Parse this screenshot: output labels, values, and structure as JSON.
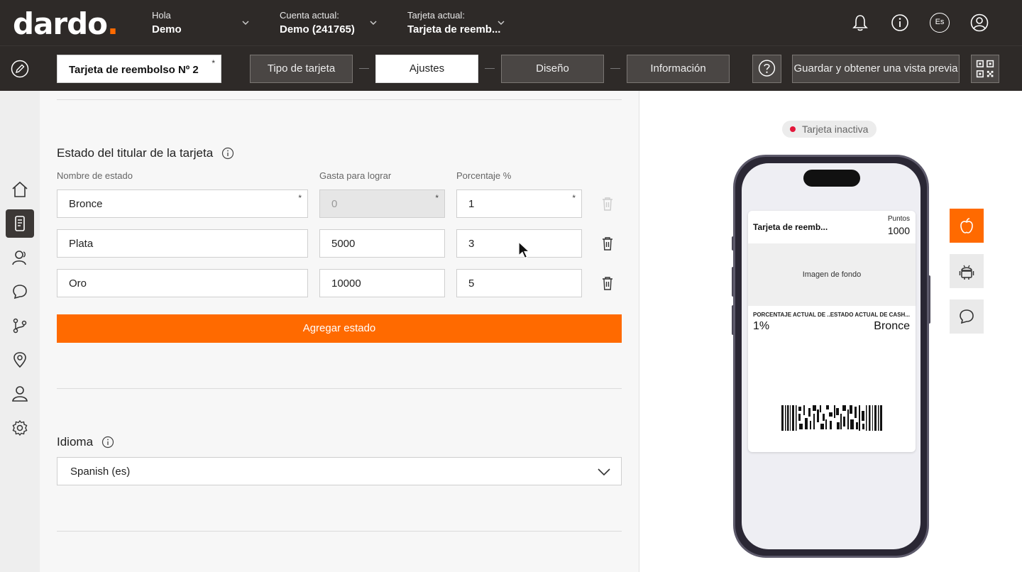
{
  "header": {
    "logo_text": "dardo",
    "logo_dot": ".",
    "greeting_label": "Hola",
    "greeting_name": "Demo",
    "account_label": "Cuenta actual:",
    "account_value": "Demo (241765)",
    "card_label": "Tarjeta actual:",
    "card_value": "Tarjeta de reemb...",
    "language_badge": "Es"
  },
  "toolbar": {
    "card_name": "Tarjeta de reembolso Nº 2",
    "required_mark": "*",
    "steps": [
      {
        "label": "Tipo de tarjeta",
        "active": false
      },
      {
        "label": "Ajustes",
        "active": true
      },
      {
        "label": "Diseño",
        "active": false
      },
      {
        "label": "Información",
        "active": false
      }
    ],
    "save_label": "Guardar y obtener una vista previa"
  },
  "holder_status": {
    "title": "Estado del titular de la tarjeta",
    "col_name": "Nombre de estado",
    "col_spend": "Gasta para lograr",
    "col_percent": "Porcentaje %",
    "rows": [
      {
        "name": "Bronce",
        "spend": "0",
        "percent": "1"
      },
      {
        "name": "Plata",
        "spend": "5000",
        "percent": "3"
      },
      {
        "name": "Oro",
        "spend": "10000",
        "percent": "5"
      }
    ],
    "add_label": "Agregar estado"
  },
  "language": {
    "title": "Idioma",
    "selected": "Spanish (es)"
  },
  "preview": {
    "status": "Tarjeta inactiva",
    "status_color": "#e3173b",
    "card_title": "Tarjeta de reemb...",
    "points_label": "Puntos",
    "points_value": "1000",
    "background_label": "Imagen de fondo",
    "field1_label": "PORCENTAJE ACTUAL DE ...",
    "field1_value": "1%",
    "field2_label": "ESTADO ACTUAL DE CASH...",
    "field2_value": "Bronce"
  },
  "colors": {
    "accent": "#ff6a00",
    "header_bg": "#2e2a28"
  },
  "icons": [
    "bell-icon",
    "info-icon",
    "user-circle-icon",
    "pencil-icon",
    "help-icon",
    "qr-code-icon",
    "home-icon",
    "card-device-icon",
    "customers-icon",
    "chat-icon",
    "flow-icon",
    "location-icon",
    "profile-icon",
    "gear-icon",
    "trash-icon",
    "chevron-down-icon",
    "apple-icon",
    "android-icon",
    "message-icon"
  ]
}
